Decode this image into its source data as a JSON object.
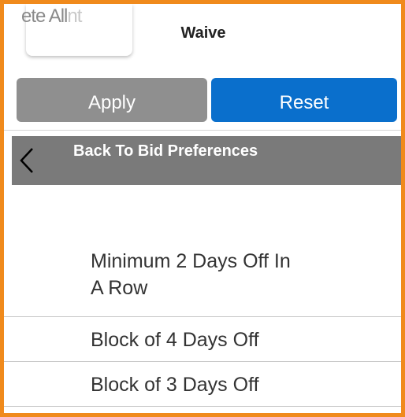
{
  "topbar": {
    "ghost_text_dark": "ete All",
    "ghost_text_faded": "nt",
    "title": "Waive"
  },
  "actions": {
    "apply_label": "Apply",
    "reset_label": "Reset"
  },
  "back": {
    "label": "Back To Bid Preferences",
    "icon": "chevron-left-icon"
  },
  "list": {
    "items": [
      {
        "line1": "Minimum 2 Days Off In",
        "line2": "A Row"
      },
      {
        "label": "Block of 4 Days Off"
      },
      {
        "label": "Block of 3 Days Off"
      }
    ]
  },
  "colors": {
    "frame": "#f08a1c",
    "apply": "#8f8f8f",
    "reset": "#0a6fcc",
    "back_bar": "#7a7a7a"
  }
}
